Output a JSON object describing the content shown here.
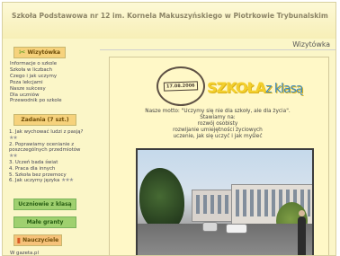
{
  "header": {
    "site_title": "Szkoła Podstawowa nr 12 im. Kornela Makuszyńskiego w Piotrkowie Trybunalskim"
  },
  "sidebar": {
    "section_intro": "Wizytówka",
    "intro_links": [
      "Informacje o szkole",
      "Szkoła w liczbach",
      "Czego i jak uczymy",
      "Poza lekcjami",
      "Nasze sukcesy",
      "Dla uczniów",
      "Przewodnik po szkole"
    ],
    "section_tasks": "Zadania (7 szt.)",
    "tasks": [
      "1. Jak wychować ludzi z pasją?",
      "2. Poprawiamy ocenianie z poszczególnych przedmiotów",
      "3. Uczeń bada świat",
      "4. Praca dla innych",
      "5. Szkoła bez przemocy",
      "6. Jak uczymy języka"
    ],
    "star_ratings": [
      "★★",
      "",
      "★★",
      "",
      "",
      "★★★"
    ],
    "section_students": "Uczniowie z klasą",
    "section_grants": "Małe granty",
    "section_teachers": "Nauczyciele",
    "teacher_link": "W gazeta.pl"
  },
  "main": {
    "page_heading": "Wizytówka",
    "stamp_date": "17.08.2006",
    "logo_bold": "SZKOŁA",
    "logo_light": "z klasą",
    "motto_lines": [
      "Nasze motto: \"Uczymy się nie dla szkoły, ale dla życia\".",
      "Stawiamy na:",
      "rozwój osobisty",
      "rozwijanie umiejętności życiowych",
      "uczenie, jak się uczyć i jak myśleć"
    ]
  },
  "icons": {
    "intro_icon": "scissors-icon",
    "teachers_icon": "book-icon"
  }
}
